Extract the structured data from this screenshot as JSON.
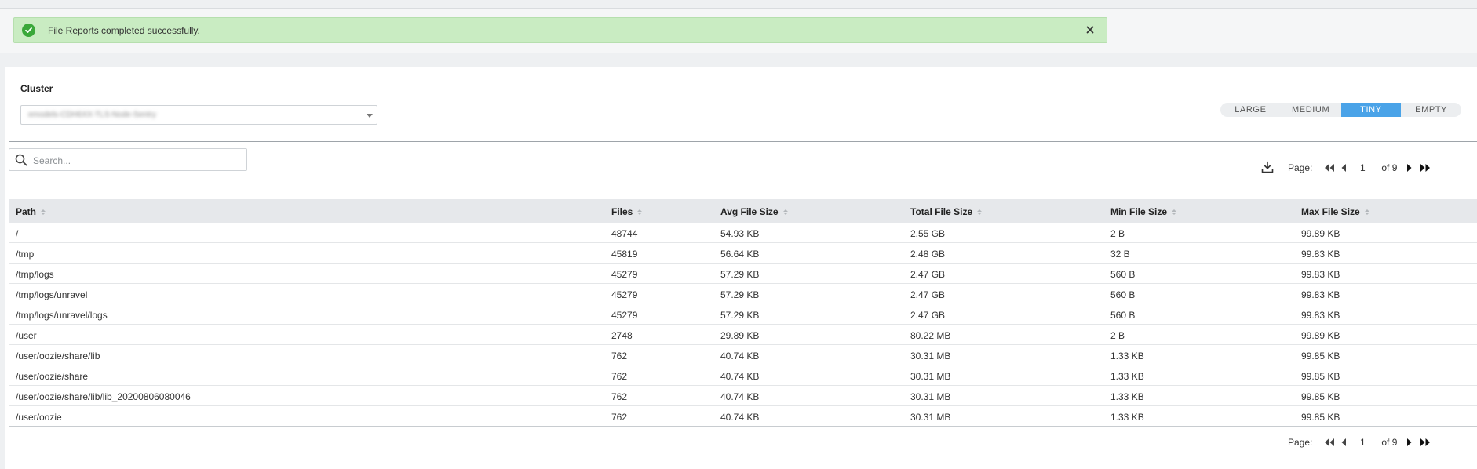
{
  "alert": {
    "message": "File Reports completed successfully.",
    "icon": "check-circle-icon",
    "close_icon": "close-icon"
  },
  "cluster": {
    "label": "Cluster",
    "value": "emodels-CDH6XX-TLS-Node-Sentry"
  },
  "size_tabs": {
    "items": [
      "LARGE",
      "MEDIUM",
      "TINY",
      "EMPTY"
    ],
    "active": "TINY",
    "active_color": "#4aa3e8"
  },
  "search": {
    "placeholder": "Search...",
    "value": ""
  },
  "pager_top": {
    "label": "Page:",
    "current": "1",
    "total": "of 9"
  },
  "pager_bottom": {
    "label": "Page:",
    "current": "1",
    "total": "of 9"
  },
  "table": {
    "columns": [
      "Path",
      "Files",
      "Avg File Size",
      "Total File Size",
      "Min File Size",
      "Max File Size"
    ],
    "rows": [
      [
        "/",
        "48744",
        "54.93 KB",
        "2.55 GB",
        "2 B",
        "99.89 KB"
      ],
      [
        "/tmp",
        "45819",
        "56.64 KB",
        "2.48 GB",
        "32 B",
        "99.83 KB"
      ],
      [
        "/tmp/logs",
        "45279",
        "57.29 KB",
        "2.47 GB",
        "560 B",
        "99.83 KB"
      ],
      [
        "/tmp/logs/unravel",
        "45279",
        "57.29 KB",
        "2.47 GB",
        "560 B",
        "99.83 KB"
      ],
      [
        "/tmp/logs/unravel/logs",
        "45279",
        "57.29 KB",
        "2.47 GB",
        "560 B",
        "99.83 KB"
      ],
      [
        "/user",
        "2748",
        "29.89 KB",
        "80.22 MB",
        "2 B",
        "99.89 KB"
      ],
      [
        "/user/oozie/share/lib",
        "762",
        "40.74 KB",
        "30.31 MB",
        "1.33 KB",
        "99.85 KB"
      ],
      [
        "/user/oozie/share",
        "762",
        "40.74 KB",
        "30.31 MB",
        "1.33 KB",
        "99.85 KB"
      ],
      [
        "/user/oozie/share/lib/lib_20200806080046",
        "762",
        "40.74 KB",
        "30.31 MB",
        "1.33 KB",
        "99.85 KB"
      ],
      [
        "/user/oozie",
        "762",
        "40.74 KB",
        "30.31 MB",
        "1.33 KB",
        "99.85 KB"
      ]
    ]
  }
}
